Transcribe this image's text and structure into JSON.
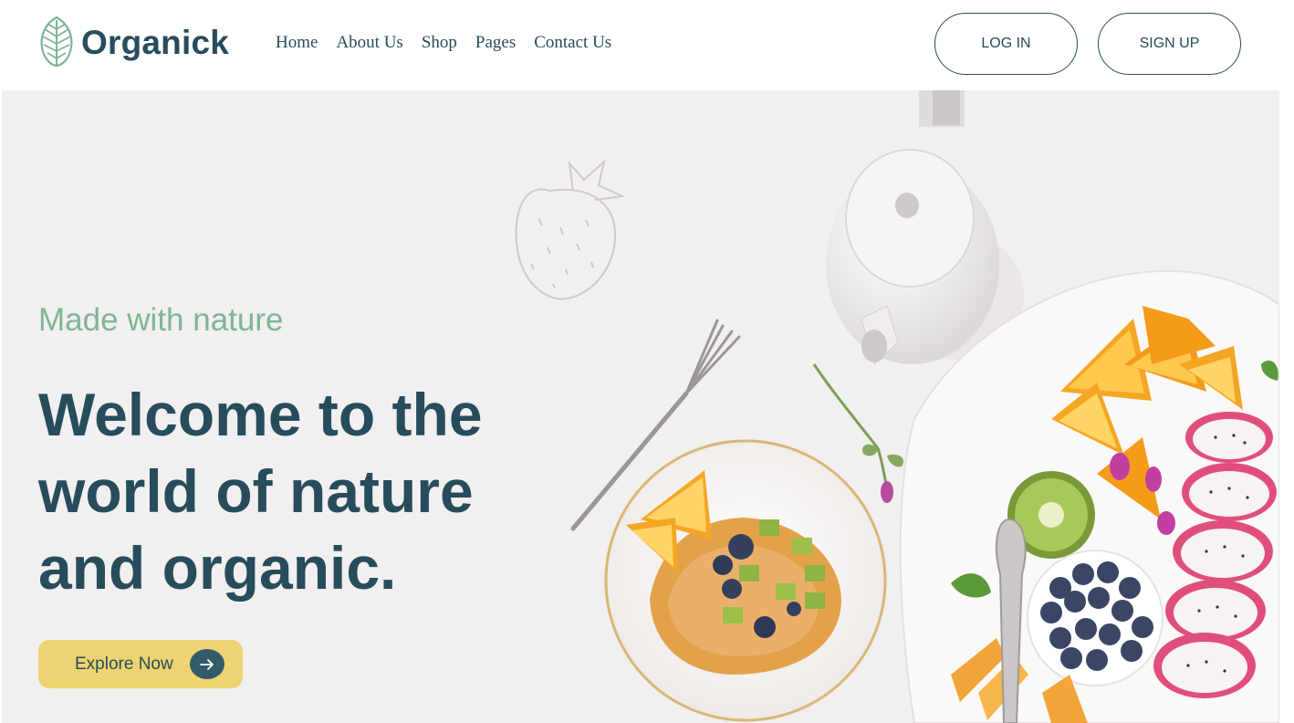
{
  "brand": {
    "name": "Organick",
    "logo_icon": "leaf-icon",
    "colors": {
      "primary": "#274c5b",
      "accent_green": "#7eb693",
      "accent_yellow": "#efd372",
      "hero_background": "#f1eff0"
    }
  },
  "nav": {
    "items": [
      {
        "label": "Home"
      },
      {
        "label": "About Us"
      },
      {
        "label": "Shop"
      },
      {
        "label": "Pages"
      },
      {
        "label": "Contact Us"
      }
    ]
  },
  "auth": {
    "login_label": "LOG IN",
    "signup_label": "SIGN UP"
  },
  "hero": {
    "subtitle": "Made with nature",
    "headline_lines": [
      "Welcome to the",
      "world of nature",
      "and organic."
    ],
    "cta_label": "Explore Now",
    "cta_icon": "arrow-right-icon"
  }
}
